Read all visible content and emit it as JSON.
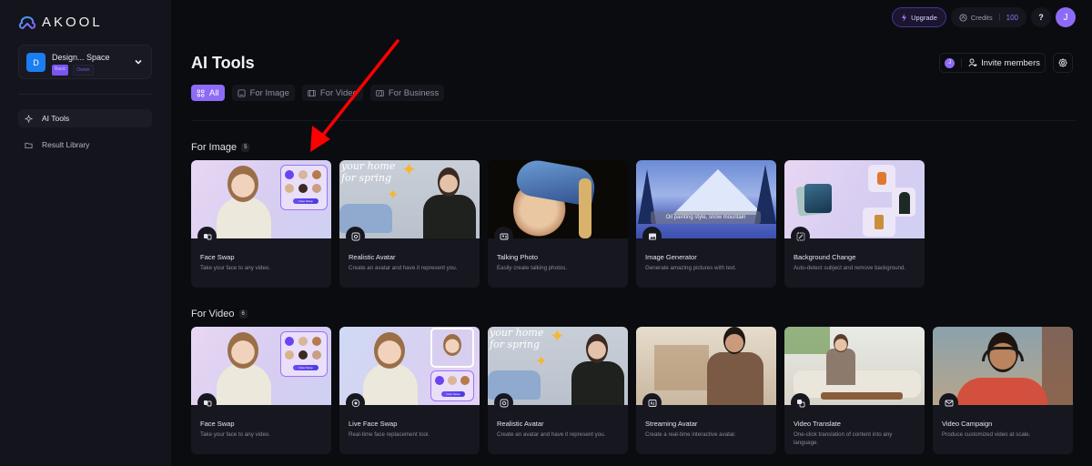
{
  "brand": {
    "name": "AKOOL"
  },
  "workspace": {
    "initial": "D",
    "name": "Design... Space",
    "plan": "Basic",
    "role": "Owner"
  },
  "sidebar": {
    "items": [
      {
        "label": "AI Tools",
        "icon": "ai-tools-icon",
        "active": true
      },
      {
        "label": "Result Library",
        "icon": "folder-icon",
        "active": false
      }
    ]
  },
  "topbar": {
    "upgrade_label": "Upgrade",
    "credits_label": "Credits",
    "credits_value": "100",
    "help_label": "?",
    "user_initial": "J"
  },
  "header": {
    "title": "AI Tools",
    "member_initial": "J",
    "invite_label": "Invite members"
  },
  "tabs": [
    {
      "label": "All",
      "active": true
    },
    {
      "label": "For Image",
      "active": false
    },
    {
      "label": "For Video",
      "active": false
    },
    {
      "label": "For Business",
      "active": false
    }
  ],
  "sections": {
    "image": {
      "title": "For Image",
      "count": "5",
      "cards": [
        {
          "title": "Face Swap",
          "desc": "Take your face to any video.",
          "icon": "face-swap-icon",
          "button": "Face Swap"
        },
        {
          "title": "Realistic Avatar",
          "desc": "Create an avatar and have it represent you.",
          "icon": "avatar-icon",
          "overlay_text": "your home for spring"
        },
        {
          "title": "Talking Photo",
          "desc": "Easily create talking photos.",
          "icon": "talking-photo-icon"
        },
        {
          "title": "Image Generator",
          "desc": "Generate amazing pictures with text.",
          "icon": "image-generator-icon",
          "overlay_text": "Oil painting style, snow mountain"
        },
        {
          "title": "Background Change",
          "desc": "Auto-detect subject and remove background.",
          "icon": "background-change-icon"
        }
      ]
    },
    "video": {
      "title": "For Video",
      "count": "6",
      "cards": [
        {
          "title": "Face Swap",
          "desc": "Take your face to any video.",
          "icon": "face-swap-icon",
          "button": "Face Swap"
        },
        {
          "title": "Live Face Swap",
          "desc": "Real-time face replacement tool.",
          "icon": "live-face-swap-icon",
          "button": "Face Swap"
        },
        {
          "title": "Realistic Avatar",
          "desc": "Create an avatar and have it represent you.",
          "icon": "avatar-icon",
          "overlay_text": "your home for spring"
        },
        {
          "title": "Streaming Avatar",
          "desc": "Create a real-time interactive avatar.",
          "icon": "streaming-avatar-icon"
        },
        {
          "title": "Video Translate",
          "desc": "One-click translation of content into any language.",
          "icon": "translate-icon"
        },
        {
          "title": "Video Campaign",
          "desc": "Produce customized video at scale.",
          "icon": "campaign-icon"
        }
      ]
    }
  },
  "annotation": {
    "type": "arrow",
    "color": "#ff0000",
    "points_to": "Face Swap card (For Image)"
  }
}
